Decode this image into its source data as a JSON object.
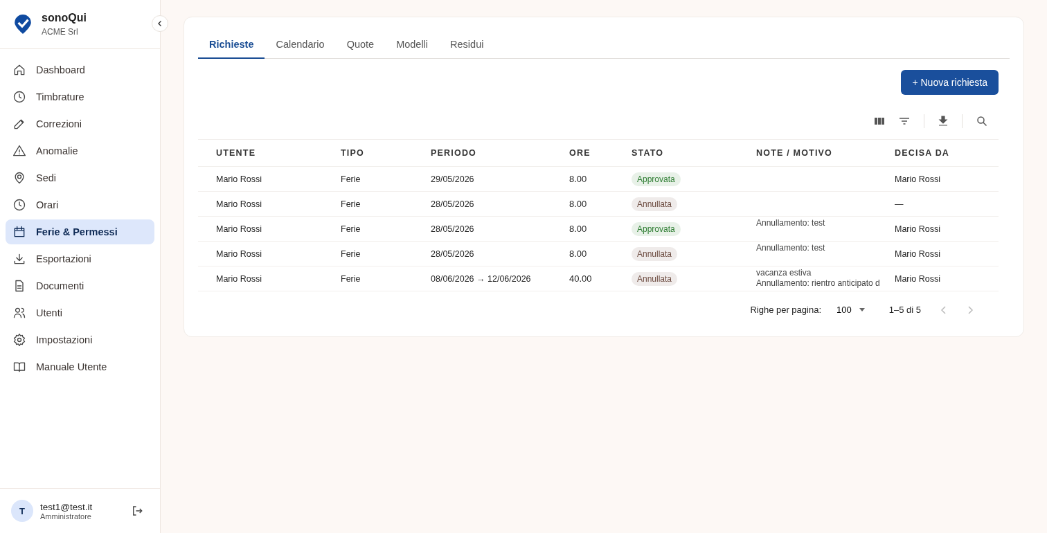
{
  "sidebar": {
    "brand": "sonoQui",
    "company": "ACME Srl",
    "items": [
      {
        "label": "Dashboard",
        "selected": false
      },
      {
        "label": "Timbrature",
        "selected": false
      },
      {
        "label": "Correzioni",
        "selected": false
      },
      {
        "label": "Anomalie",
        "selected": false
      },
      {
        "label": "Sedi",
        "selected": false
      },
      {
        "label": "Orari",
        "selected": false
      },
      {
        "label": "Ferie & Permessi",
        "selected": true
      },
      {
        "label": "Esportazioni",
        "selected": false
      },
      {
        "label": "Documenti",
        "selected": false
      },
      {
        "label": "Utenti",
        "selected": false
      },
      {
        "label": "Impostazioni",
        "selected": false
      },
      {
        "label": "Manuale Utente",
        "selected": false
      }
    ],
    "user": {
      "initial": "T",
      "email": "test1@test.it",
      "role": "Amministratore"
    }
  },
  "tabs": [
    {
      "label": "Richieste",
      "selected": true
    },
    {
      "label": "Calendario",
      "selected": false
    },
    {
      "label": "Quote",
      "selected": false
    },
    {
      "label": "Modelli",
      "selected": false
    },
    {
      "label": "Residui",
      "selected": false
    }
  ],
  "new_button": "+ Nuova richiesta",
  "table": {
    "columns": [
      "UTENTE",
      "TIPO",
      "PERIODO",
      "ORE",
      "STATO",
      "NOTE / MOTIVO",
      "DECISA DA"
    ],
    "rows": [
      {
        "user": "Mario Rossi",
        "type": "Ferie",
        "period": "29/05/2026",
        "hours": "8.00",
        "status": {
          "label": "Approvata",
          "color": "#2e7d32"
        },
        "notes": [],
        "decided_by": "Mario Rossi"
      },
      {
        "user": "Mario Rossi",
        "type": "Ferie",
        "period": "28/05/2026",
        "hours": "8.00",
        "status": {
          "label": "Annullata",
          "color": "#6d4c41"
        },
        "notes": [],
        "decided_by": "—"
      },
      {
        "user": "Mario Rossi",
        "type": "Ferie",
        "period": "28/05/2026",
        "hours": "8.00",
        "status": {
          "label": "Approvata",
          "color": "#2e7d32"
        },
        "notes": [
          "Annullamento: test"
        ],
        "decided_by": "Mario Rossi"
      },
      {
        "user": "Mario Rossi",
        "type": "Ferie",
        "period": "28/05/2026",
        "hours": "8.00",
        "status": {
          "label": "Annullata",
          "color": "#6d4c41"
        },
        "notes": [
          "Annullamento: test"
        ],
        "decided_by": "Mario Rossi"
      },
      {
        "user": "Mario Rossi",
        "type": "Ferie",
        "period": "08/06/2026 → 12/06/2026",
        "hours": "40.00",
        "status": {
          "label": "Annullata",
          "color": "#6d4c41"
        },
        "notes": [
          "vacanza estiva",
          "Annullamento: rientro anticipato d"
        ],
        "decided_by": "Mario Rossi"
      }
    ]
  },
  "pagination": {
    "rows_label": "Righe per pagina:",
    "rows_value": "100",
    "range": "1–5 di 5"
  }
}
